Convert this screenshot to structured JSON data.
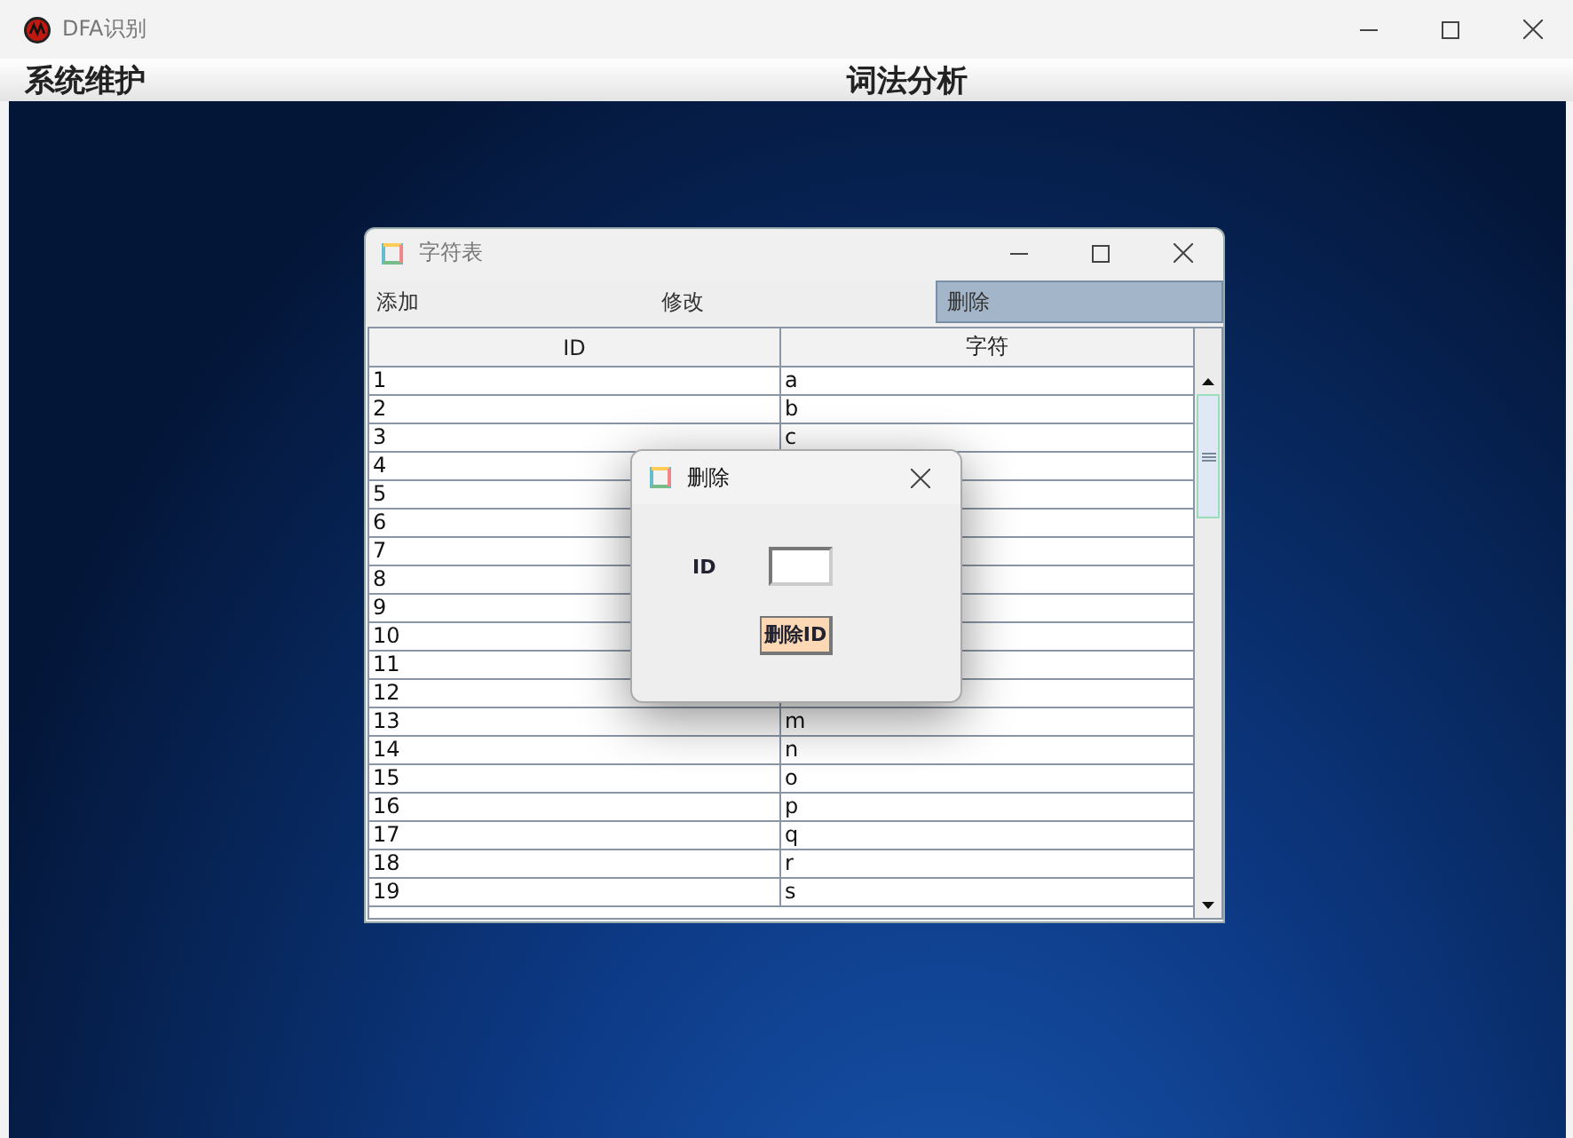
{
  "window": {
    "title": "DFA识别"
  },
  "menu_bar": [
    {
      "label": "系统维护"
    },
    {
      "label": "词法分析"
    }
  ],
  "internal_frame": {
    "title": "字符表",
    "buttons": [
      {
        "label": "添加",
        "selected": false
      },
      {
        "label": "修改",
        "selected": false
      },
      {
        "label": "删除",
        "selected": true
      }
    ],
    "table": {
      "columns": [
        "ID",
        "字符"
      ],
      "rows": [
        {
          "id": "1",
          "char": "a"
        },
        {
          "id": "2",
          "char": "b"
        },
        {
          "id": "3",
          "char": "c"
        },
        {
          "id": "4"
        },
        {
          "id": "5"
        },
        {
          "id": "6"
        },
        {
          "id": "7"
        },
        {
          "id": "8"
        },
        {
          "id": "9"
        },
        {
          "id": "10"
        },
        {
          "id": "11"
        },
        {
          "id": "12"
        },
        {
          "id": "13",
          "char": "m"
        },
        {
          "id": "14",
          "char": "n"
        },
        {
          "id": "15",
          "char": "o"
        },
        {
          "id": "16",
          "char": "p"
        },
        {
          "id": "17",
          "char": "q"
        },
        {
          "id": "18",
          "char": "r"
        },
        {
          "id": "19",
          "char": "s"
        }
      ]
    }
  },
  "dialog": {
    "title": "删除",
    "field_label": "ID",
    "button": "删除ID"
  }
}
